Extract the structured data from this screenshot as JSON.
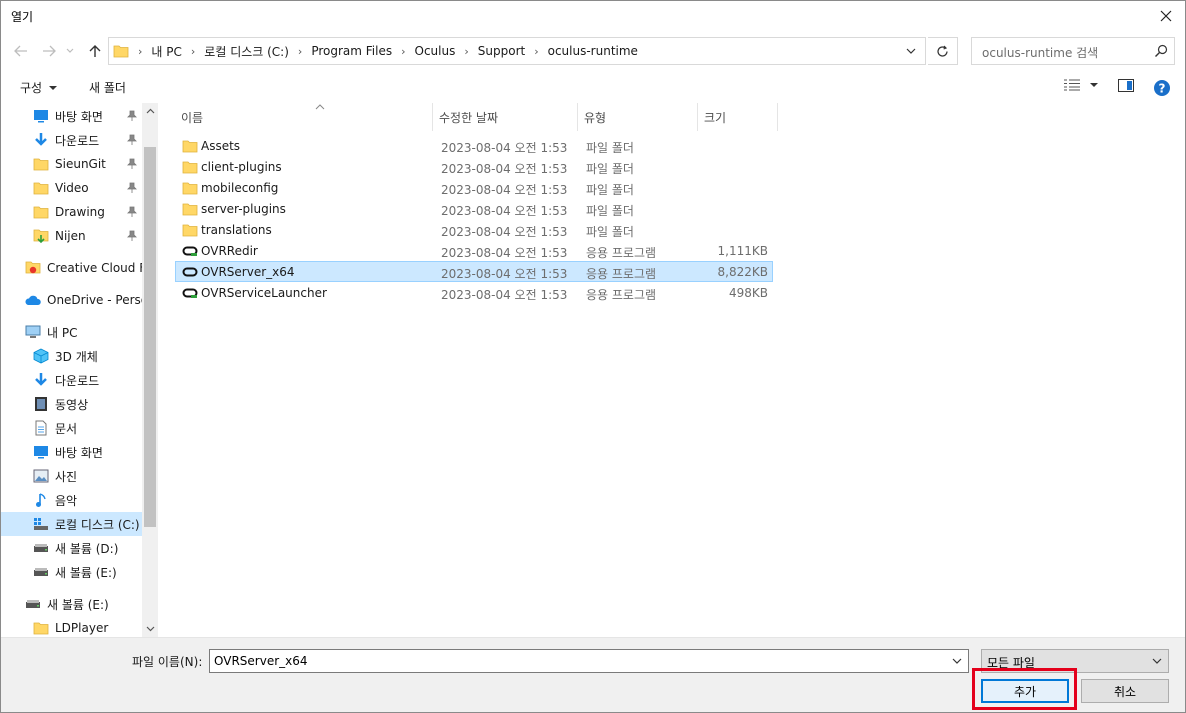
{
  "window": {
    "title": "열기"
  },
  "address": {
    "crumbs": [
      "내 PC",
      "로컬 디스크 (C:)",
      "Program Files",
      "Oculus",
      "Support",
      "oculus-runtime"
    ]
  },
  "search": {
    "placeholder": "oculus-runtime 검색"
  },
  "toolbar": {
    "organize": "구성",
    "new_folder": "새 폴더"
  },
  "sidebar": {
    "quick_access": [
      {
        "label": "바탕 화면",
        "icon": "desktop-icon",
        "pinned": true
      },
      {
        "label": "다운로드",
        "icon": "download-icon",
        "pinned": true
      },
      {
        "label": "SieunGit",
        "icon": "folder-icon",
        "pinned": true
      },
      {
        "label": "Video",
        "icon": "folder-icon",
        "pinned": true
      },
      {
        "label": "Drawing",
        "icon": "folder-icon",
        "pinned": true
      },
      {
        "label": "Nijen",
        "icon": "folder-download-icon",
        "pinned": true
      }
    ],
    "creative_cloud": "Creative Cloud Fil",
    "onedrive": "OneDrive - Person",
    "this_pc": "내 PC",
    "this_pc_items": [
      {
        "label": "3D 개체",
        "icon": "3d-objects-icon"
      },
      {
        "label": "다운로드",
        "icon": "download-icon"
      },
      {
        "label": "동영상",
        "icon": "video-icon"
      },
      {
        "label": "문서",
        "icon": "document-icon"
      },
      {
        "label": "바탕 화면",
        "icon": "desktop-icon"
      },
      {
        "label": "사진",
        "icon": "picture-icon"
      },
      {
        "label": "음악",
        "icon": "music-icon"
      },
      {
        "label": "로컬 디스크 (C:)",
        "icon": "local-disk-icon",
        "selected": true
      },
      {
        "label": "새 볼륨 (D:)",
        "icon": "drive-icon"
      },
      {
        "label": "새 볼륨 (E:)",
        "icon": "drive-icon"
      }
    ],
    "network_drive": "새 볼륨 (E:)",
    "ldplayer": "LDPlayer"
  },
  "columns": {
    "name": "이름",
    "date": "수정한 날짜",
    "type": "유형",
    "size": "크기"
  },
  "files": [
    {
      "name": "Assets",
      "date": "2023-08-04 오전 1:53",
      "type": "파일 폴더",
      "size": "",
      "kind": "folder"
    },
    {
      "name": "client-plugins",
      "date": "2023-08-04 오전 1:53",
      "type": "파일 폴더",
      "size": "",
      "kind": "folder"
    },
    {
      "name": "mobileconfig",
      "date": "2023-08-04 오전 1:53",
      "type": "파일 폴더",
      "size": "",
      "kind": "folder"
    },
    {
      "name": "server-plugins",
      "date": "2023-08-04 오전 1:53",
      "type": "파일 폴더",
      "size": "",
      "kind": "folder"
    },
    {
      "name": "translations",
      "date": "2023-08-04 오전 1:53",
      "type": "파일 폴더",
      "size": "",
      "kind": "folder"
    },
    {
      "name": "OVRRedir",
      "date": "2023-08-04 오전 1:53",
      "type": "응용 프로그램",
      "size": "1,111KB",
      "kind": "app"
    },
    {
      "name": "OVRServer_x64",
      "date": "2023-08-04 오전 1:53",
      "type": "응용 프로그램",
      "size": "8,822KB",
      "kind": "app",
      "selected": true
    },
    {
      "name": "OVRServiceLauncher",
      "date": "2023-08-04 오전 1:53",
      "type": "응용 프로그램",
      "size": "498KB",
      "kind": "app"
    }
  ],
  "footer": {
    "filename_label": "파일 이름(N):",
    "filename_value": "OVRServer_x64",
    "filetype_value": "모든 파일",
    "add_button": "추가",
    "cancel_button": "취소"
  },
  "colors": {
    "selection": "#cce8ff",
    "selection_border": "#99d1ff",
    "accent": "#0078d7",
    "highlight": "#e4001b",
    "help": "#1a6fc9"
  }
}
